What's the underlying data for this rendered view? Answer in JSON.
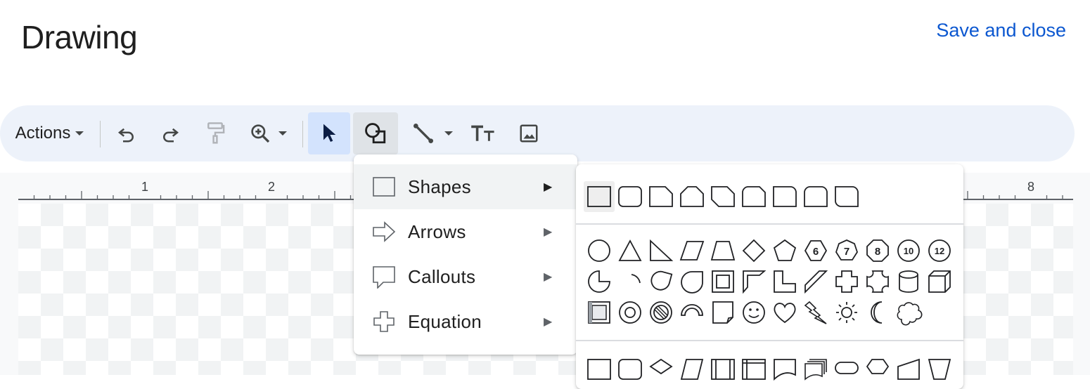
{
  "header": {
    "title": "Drawing",
    "save_label": "Save and close"
  },
  "toolbar": {
    "actions_label": "Actions",
    "tools": [
      {
        "name": "undo-icon"
      },
      {
        "name": "redo-icon"
      },
      {
        "name": "paint-format-icon"
      },
      {
        "name": "zoom-icon"
      },
      {
        "name": "select-cursor-icon"
      },
      {
        "name": "shape-icon"
      },
      {
        "name": "line-icon"
      },
      {
        "name": "text-box-icon"
      },
      {
        "name": "image-icon"
      }
    ]
  },
  "ruler": {
    "labels": [
      "1",
      "2",
      "8"
    ]
  },
  "menu": {
    "items": [
      {
        "label": "Shapes",
        "icon": "square-outline-icon",
        "selected": true
      },
      {
        "label": "Arrows",
        "icon": "arrow-outline-icon",
        "selected": false
      },
      {
        "label": "Callouts",
        "icon": "callout-outline-icon",
        "selected": false
      },
      {
        "label": "Equation",
        "icon": "plus-outline-icon",
        "selected": false
      }
    ],
    "submenu_arrow": "▶"
  },
  "shapes_panel": {
    "badges": [
      "6",
      "7",
      "8",
      "10",
      "12"
    ]
  },
  "colors": {
    "accent": "#0b57d0",
    "toolbar_bg": "#edf2fa",
    "active_tool": "#d3e3fd"
  }
}
